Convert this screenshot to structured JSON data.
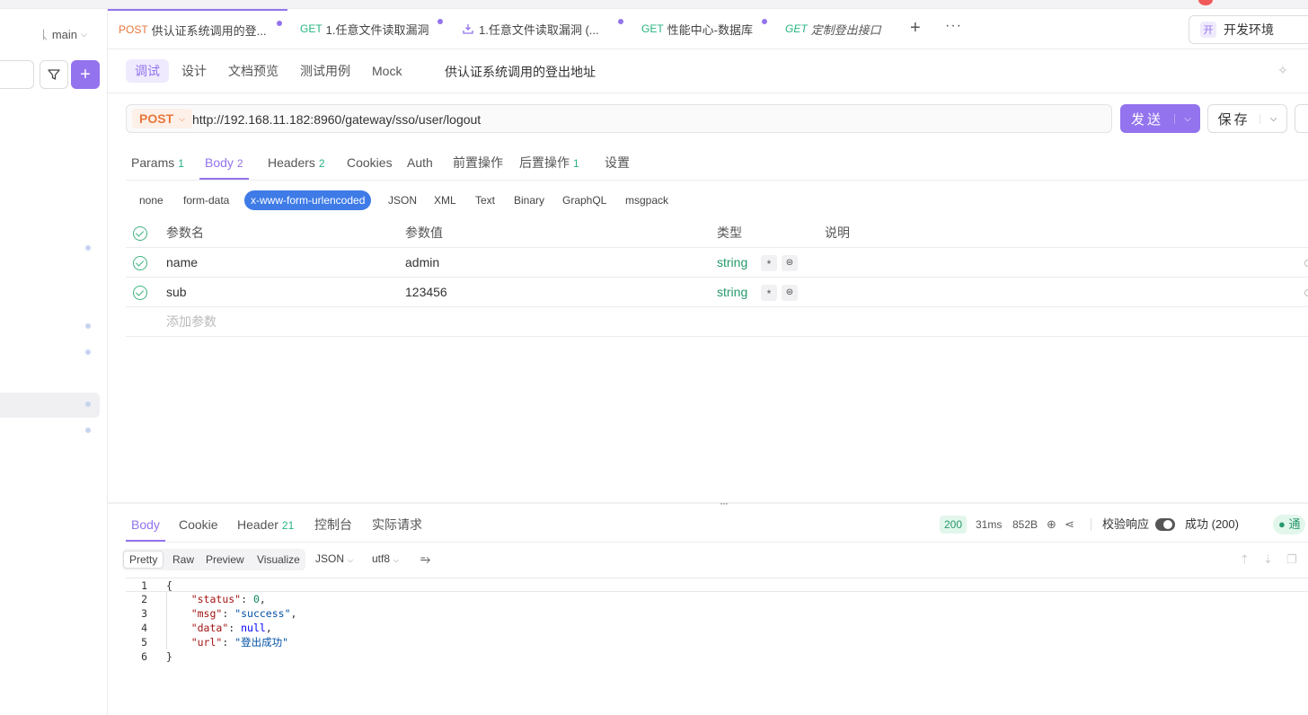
{
  "sidebar": {
    "branch": "main"
  },
  "tabs": [
    {
      "method": "POST",
      "title": "供认证系统调用的登...",
      "active": true,
      "modified": true
    },
    {
      "method": "GET",
      "title": "1.任意文件读取漏洞",
      "active": false,
      "modified": true
    },
    {
      "method": "",
      "title": "1.任意文件读取漏洞 (...",
      "active": false,
      "modified": true
    },
    {
      "method": "GET",
      "title": "性能中心-数据库",
      "active": false,
      "modified": true
    },
    {
      "method": "GET",
      "title": "定制登出接口",
      "active": false,
      "modified": false
    }
  ],
  "environment": {
    "badge": "开",
    "label": "开发环境"
  },
  "subtabs": [
    "调试",
    "设计",
    "文档预览",
    "测试用例",
    "Mock"
  ],
  "api_name": "供认证系统调用的登出地址",
  "request": {
    "method": "POST",
    "url": "http://192.168.11.182:8960/gateway/sso/user/logout",
    "send_label": "发送",
    "save_label": "保存"
  },
  "request_tabs": [
    {
      "label": "Params",
      "count": "1"
    },
    {
      "label": "Body",
      "count": "2"
    },
    {
      "label": "Headers",
      "count": "2"
    },
    {
      "label": "Cookies",
      "count": ""
    },
    {
      "label": "Auth",
      "count": ""
    },
    {
      "label": "前置操作",
      "count": ""
    },
    {
      "label": "后置操作",
      "count": "1"
    },
    {
      "label": "设置",
      "count": ""
    }
  ],
  "body_types": [
    "none",
    "form-data",
    "x-www-form-urlencoded",
    "JSON",
    "XML",
    "Text",
    "Binary",
    "GraphQL",
    "msgpack"
  ],
  "params_table": {
    "headers": [
      "参数名",
      "参数值",
      "类型",
      "说明"
    ],
    "rows": [
      {
        "name": "name",
        "value": "admin",
        "type": "string",
        "required": "*"
      },
      {
        "name": "sub",
        "value": "123456",
        "type": "string",
        "required": "*"
      }
    ],
    "add_placeholder": "添加参数"
  },
  "response": {
    "tabs": [
      {
        "label": "Body",
        "count": ""
      },
      {
        "label": "Cookie",
        "count": ""
      },
      {
        "label": "Header",
        "count": "21"
      },
      {
        "label": "控制台",
        "count": ""
      },
      {
        "label": "实际请求",
        "count": ""
      }
    ],
    "status": "200",
    "time": "31ms",
    "size": "852B",
    "validate_label": "校验响应",
    "validate_result": "成功 (200)",
    "pass_label": "● 通",
    "views": [
      "Pretty",
      "Raw",
      "Preview",
      "Visualize"
    ],
    "format": "JSON",
    "encoding": "utf8",
    "code_lines": [
      {
        "no": "1",
        "text": "{"
      },
      {
        "no": "2",
        "text": "    \"status\": 0,"
      },
      {
        "no": "3",
        "text": "    \"msg\": \"success\","
      },
      {
        "no": "4",
        "text": "    \"data\": null,"
      },
      {
        "no": "5",
        "text": "    \"url\": \"登出成功\""
      },
      {
        "no": "6",
        "text": "}"
      }
    ]
  },
  "colors": {
    "accent": "#9373ee",
    "post": "#e8783d",
    "get": "#26b47f",
    "body_type_active": "#3e7be7"
  }
}
